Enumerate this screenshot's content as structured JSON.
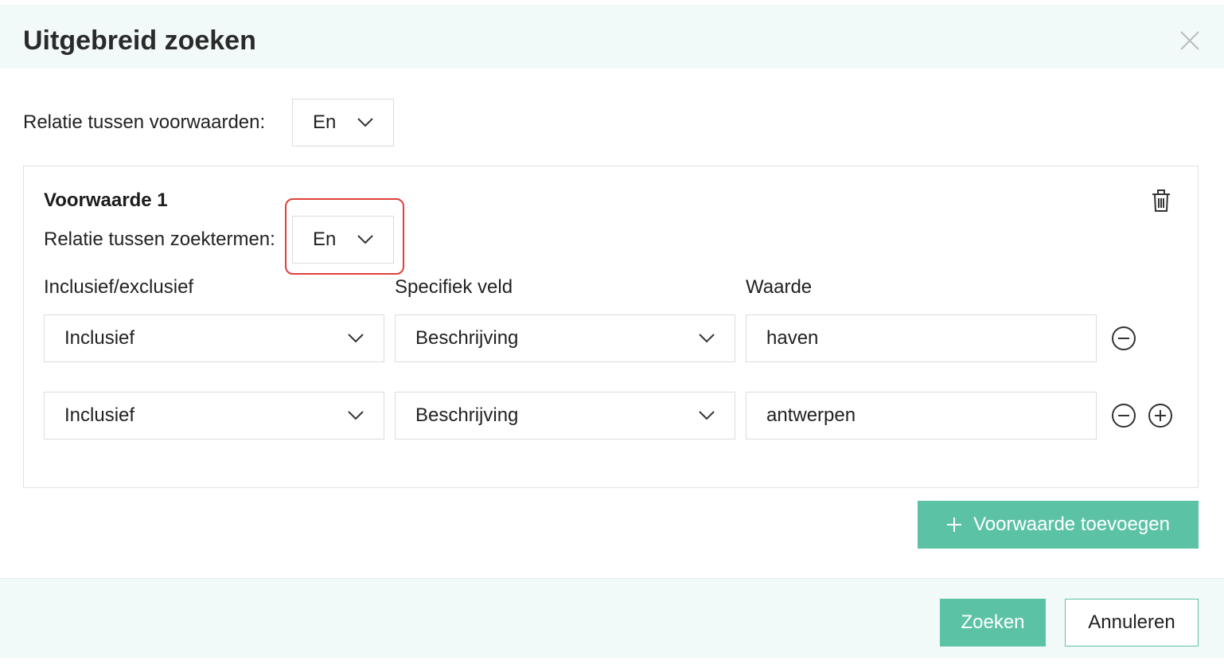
{
  "dialog": {
    "title": "Uitgebreid zoeken"
  },
  "global_relation": {
    "label": "Relatie tussen voorwaarden:",
    "value": "En"
  },
  "condition": {
    "title": "Voorwaarde 1",
    "relation_label": "Relatie tussen zoektermen:",
    "relation_value": "En",
    "column_headers": [
      "Inclusief/exclusief",
      "Specifiek veld",
      "Waarde"
    ],
    "rows": [
      {
        "inclusion": "Inclusief",
        "field": "Beschrijving",
        "value": "haven"
      },
      {
        "inclusion": "Inclusief",
        "field": "Beschrijving",
        "value": "antwerpen"
      }
    ]
  },
  "actions": {
    "add_condition": "Voorwaarde toevoegen",
    "search": "Zoeken",
    "cancel": "Annuleren"
  },
  "colors": {
    "accent": "#5cc2a6",
    "header_bg": "#f2f9f9",
    "highlight": "#e0403a"
  },
  "icons": {
    "close": "close-icon",
    "chevron": "chevron-down-icon",
    "delete": "trash-icon",
    "remove_row": "minus-circle-icon",
    "add_row": "plus-circle-icon",
    "add": "plus-icon"
  }
}
